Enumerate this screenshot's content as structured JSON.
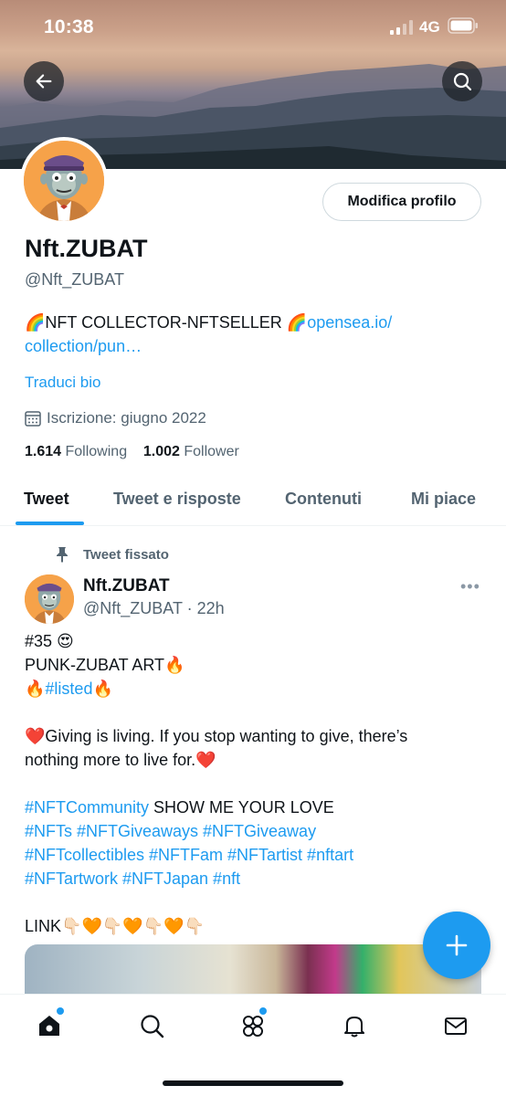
{
  "status_bar": {
    "time": "10:38",
    "network": "4G"
  },
  "header": {
    "back_icon": "arrow-left-icon",
    "search_icon": "search-icon"
  },
  "profile": {
    "edit_button": "Modifica profilo",
    "name": "Nft.ZUBAT",
    "handle": "@Nft_ZUBAT",
    "bio_emoji": "🌈",
    "bio_text": "NFT COLLECTOR-NFTSELLER ",
    "bio_link_line1": "opensea.io/",
    "bio_link_line2": "collection/pun…",
    "translate": "Traduci bio",
    "joined": "Iscrizione: giugno 2022",
    "following_count": "1.614",
    "following_label": "Following",
    "follower_count": "1.002",
    "follower_label": "Follower"
  },
  "tabs": [
    {
      "label": "Tweet",
      "active": true
    },
    {
      "label": "Tweet e risposte",
      "active": false
    },
    {
      "label": "Contenuti",
      "active": false
    },
    {
      "label": "Mi piace",
      "active": false
    }
  ],
  "tweet": {
    "pinned_label": "Tweet fissato",
    "author_name": "Nft.ZUBAT",
    "author_handle": "@Nft_ZUBAT",
    "time": " · 22h",
    "more": "•••",
    "lines": {
      "l1_text": "#35 ",
      "l1_emoji": "😍",
      "l2_text": "PUNK-ZUBAT ART",
      "l2_emoji": "🔥",
      "l3_pre": "🔥",
      "l3_tag": "#listed",
      "l3_post": "🔥",
      "l4_emoji": "❤️",
      "l4_text": "Giving is living. If you stop wanting to give, there’s",
      "l5_text": "nothing more to live for.",
      "l5_emoji": "❤️",
      "l6_tag": "#NFTCommunity",
      "l6_text": " SHOW ME YOUR LOVE",
      "l7_tags": "#NFTs #NFTGiveaways #NFTGiveaway",
      "l8_tags": "#NFTcollectibles #NFTFam #NFTartist #nftart",
      "l9_tags": "#NFTartwork #NFTJapan #nft",
      "l10_text": "LINK",
      "l10_emojis": "👇🏻🧡👇🏻🧡👇🏻🧡👇🏻"
    }
  },
  "fab": {
    "icon": "plus-icon"
  },
  "bottom_nav": [
    "home-icon",
    "search-icon",
    "communities-icon",
    "bell-icon",
    "mail-icon"
  ],
  "colors": {
    "accent": "#1d9bf0",
    "text": "#0f1419",
    "muted": "#536471"
  }
}
